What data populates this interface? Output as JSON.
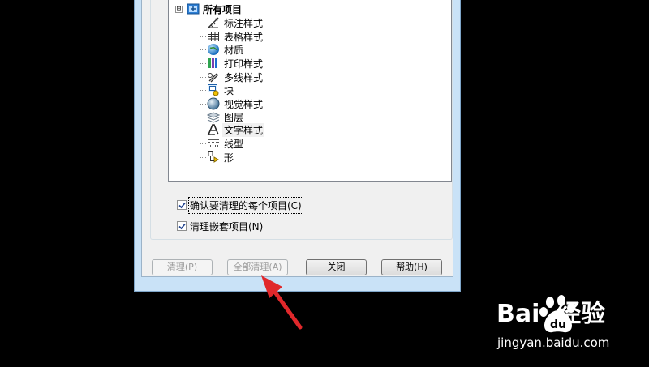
{
  "tree": {
    "root": {
      "label": "所有项目",
      "expander": "⊟"
    },
    "items": [
      {
        "label": "标注样式",
        "icon": "dimension-style-icon"
      },
      {
        "label": "表格样式",
        "icon": "table-style-icon"
      },
      {
        "label": "材质",
        "icon": "material-globe-icon"
      },
      {
        "label": "打印样式",
        "icon": "plot-style-icon"
      },
      {
        "label": "多线样式",
        "icon": "multiline-style-icon"
      },
      {
        "label": "块",
        "icon": "block-icon"
      },
      {
        "label": "视觉样式",
        "icon": "visual-style-icon"
      },
      {
        "label": "图层",
        "icon": "layers-icon"
      },
      {
        "label": "文字样式",
        "icon": "text-style-icon"
      },
      {
        "label": "线型",
        "icon": "linetype-icon"
      },
      {
        "label": "形",
        "icon": "shape-icon"
      }
    ]
  },
  "options": {
    "confirm_each": {
      "label": "确认要清理的每个项目(C)",
      "checked": true
    },
    "purge_nested": {
      "label": "清理嵌套项目(N)",
      "checked": true
    }
  },
  "buttons": {
    "purge": "清理(P)",
    "purge_all": "全部清理(A)",
    "close": "关闭",
    "help": "帮助(H)"
  },
  "watermark": {
    "brand": "Bai  经验",
    "url": "jingyan.baidu.com"
  }
}
